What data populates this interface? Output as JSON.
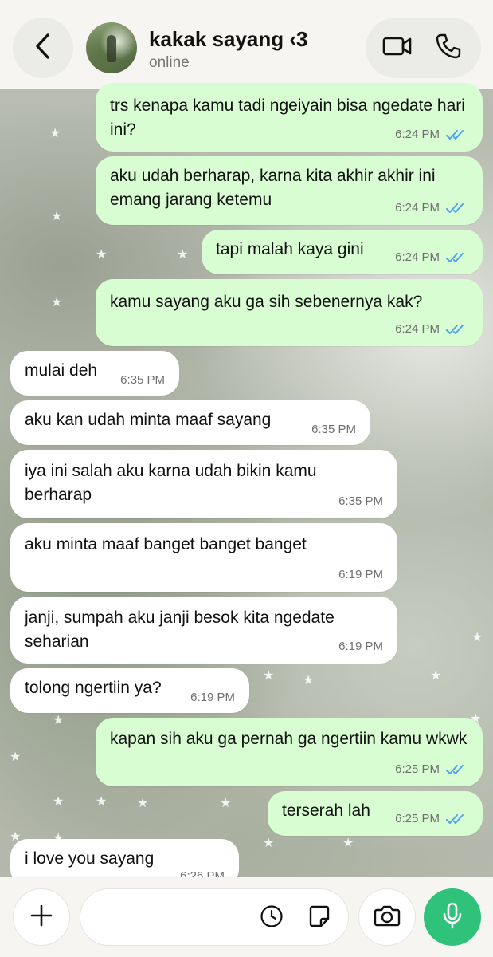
{
  "header": {
    "contact_name": "kakak sayang ‹3",
    "status": "online"
  },
  "colors": {
    "outgoing_bubble": "#d8fdd2",
    "incoming_bubble": "#ffffff",
    "read_ticks": "#4fa3e8",
    "mic_button": "#2fc27a"
  },
  "messages": [
    {
      "direction": "out",
      "text": "trs kenapa kamu tadi ngeiyain bisa ngedate hari ini?",
      "time": "6:24 PM",
      "status": "read"
    },
    {
      "direction": "out",
      "text": "aku udah berharap, karna kita akhir akhir ini emang jarang ketemu",
      "time": "6:24 PM",
      "status": "read"
    },
    {
      "direction": "out",
      "text": "tapi malah kaya gini",
      "time": "6:24 PM",
      "status": "read"
    },
    {
      "direction": "out",
      "text": "kamu sayang aku ga sih sebenernya kak?",
      "time": "6:24 PM",
      "status": "read"
    },
    {
      "direction": "in",
      "text": "mulai deh",
      "time": "6:35 PM"
    },
    {
      "direction": "in",
      "text": "aku kan udah minta maaf sayang",
      "time": "6:35 PM"
    },
    {
      "direction": "in",
      "text": "iya ini salah aku karna udah bikin kamu berharap",
      "time": "6:35 PM"
    },
    {
      "direction": "in",
      "text": "aku minta maaf banget banget banget",
      "time": "6:19 PM"
    },
    {
      "direction": "in",
      "text": "janji, sumpah aku janji besok kita ngedate seharian",
      "time": "6:19 PM"
    },
    {
      "direction": "in",
      "text": "tolong ngertiin ya?",
      "time": "6:19 PM"
    },
    {
      "direction": "out",
      "text": "kapan sih aku ga pernah ga ngertiin kamu wkwk",
      "time": "6:25 PM",
      "status": "read"
    },
    {
      "direction": "out",
      "text": "terserah lah",
      "time": "6:25 PM",
      "status": "read"
    },
    {
      "direction": "in",
      "text": "i love you sayang",
      "time": "6:26 PM"
    }
  ],
  "composer": {
    "placeholder": ""
  },
  "icons": {
    "back": "chevron-left-icon",
    "video": "video-camera-icon",
    "phone": "phone-icon",
    "plus": "plus-icon",
    "clock": "clock-icon",
    "sticker": "sticker-icon",
    "camera": "camera-icon",
    "mic": "microphone-icon"
  }
}
